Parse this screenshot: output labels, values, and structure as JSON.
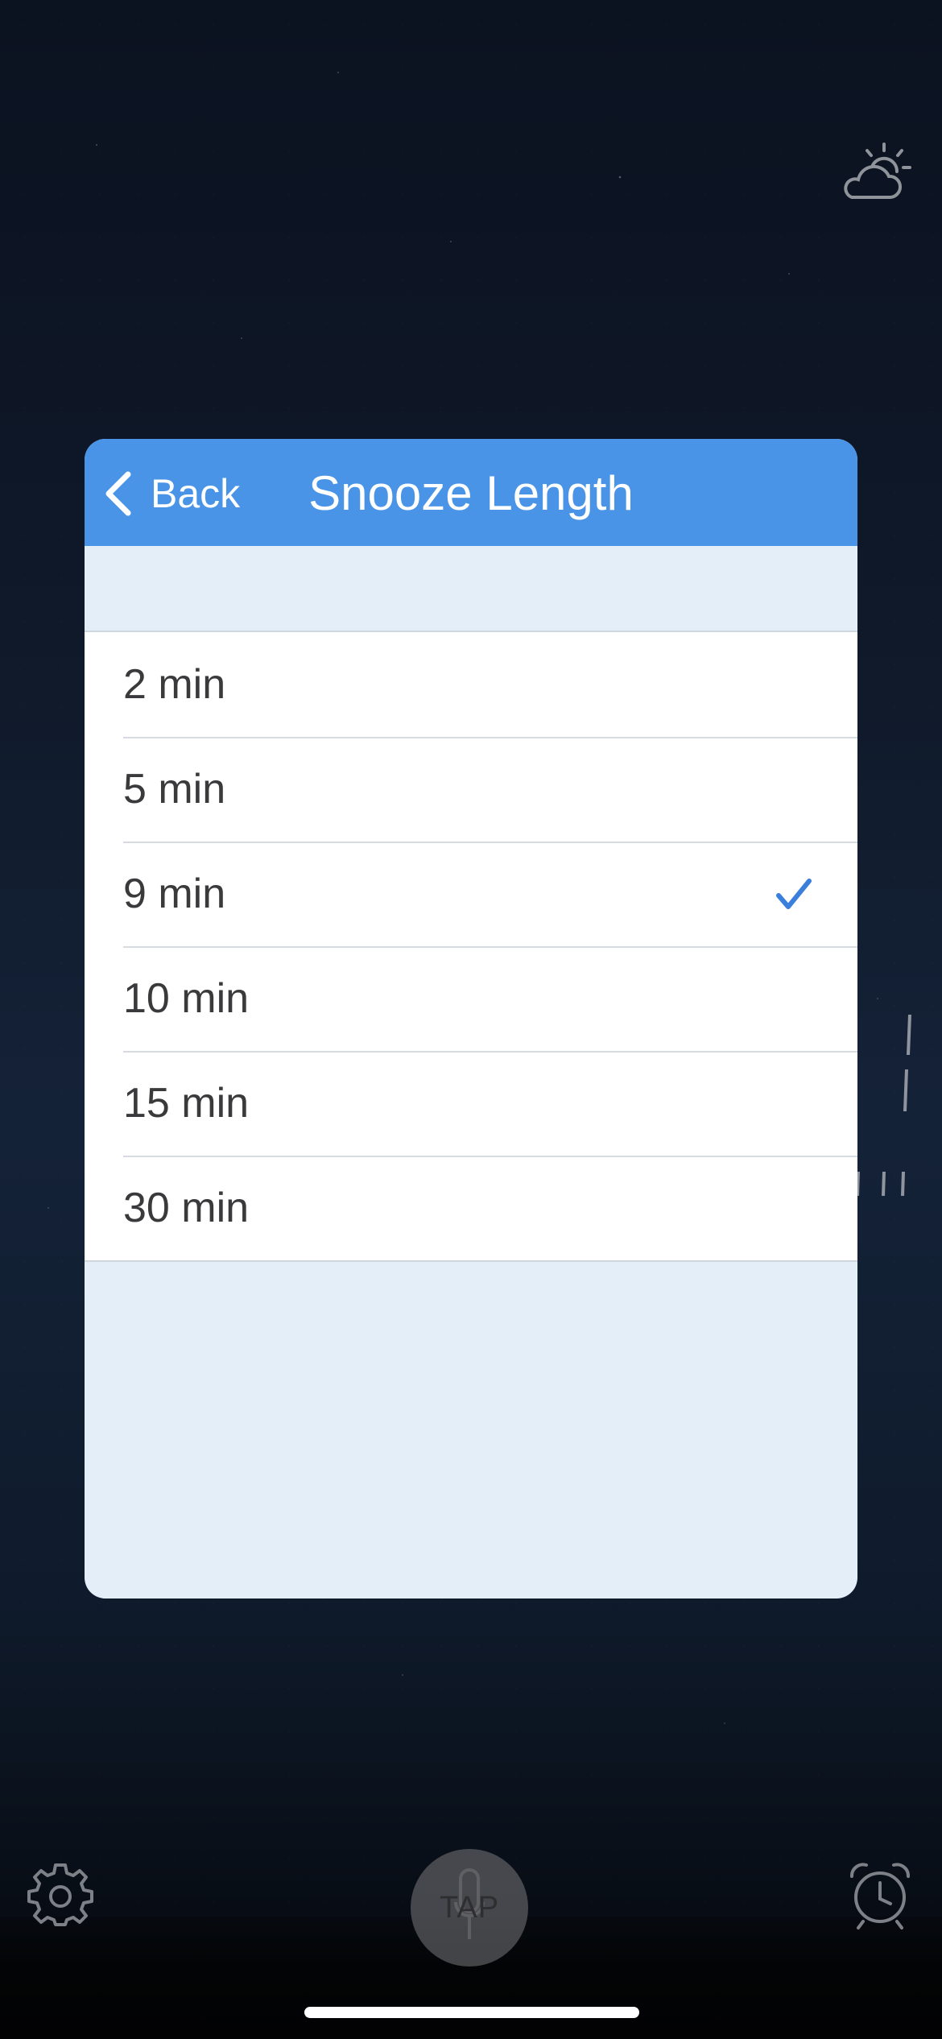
{
  "header": {
    "back_label": "Back",
    "title": "Snooze Length"
  },
  "snooze_options": [
    {
      "label": "2 min",
      "selected": false
    },
    {
      "label": "5 min",
      "selected": false
    },
    {
      "label": "9 min",
      "selected": true
    },
    {
      "label": "10 min",
      "selected": false
    },
    {
      "label": "15 min",
      "selected": false
    },
    {
      "label": "30 min",
      "selected": false
    }
  ],
  "bottom_bar": {
    "tap_label": "TAP",
    "left_icon": "gear-icon",
    "right_icon": "alarm-clock-icon"
  },
  "top_icon": "partly-cloudy-icon",
  "colors": {
    "header": "#4a94e8",
    "check": "#3b7fdc",
    "modal_bg": "#e4eef9"
  }
}
